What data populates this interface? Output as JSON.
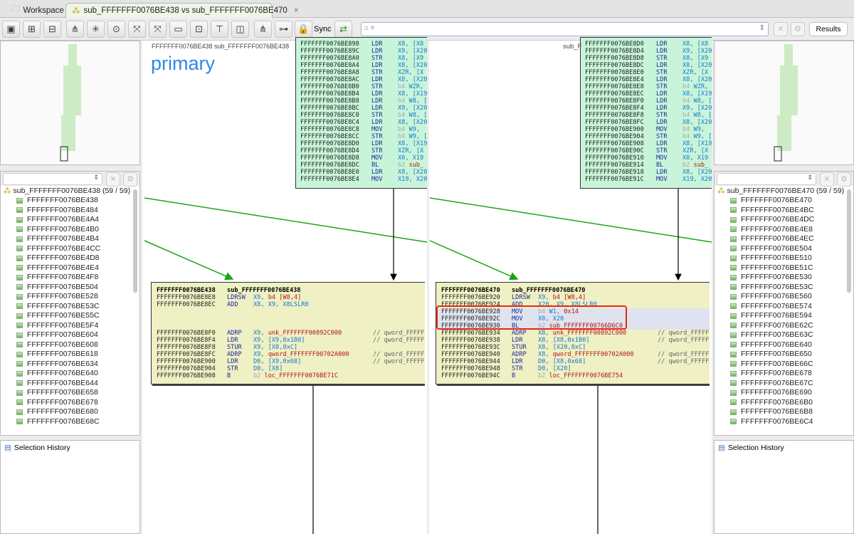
{
  "tabs": {
    "workspace": "Workspace",
    "diff": "sub_FFFFFFF0076BE438 vs sub_FFFFFFF0076BE470",
    "close": "×"
  },
  "toolbar": {
    "sync_label": "Sync",
    "results_label": "Results",
    "icons": [
      "single-view-icon",
      "dual-view-icon",
      "combined-view-icon",
      "hierarchic-layout-icon",
      "orthogonal-layout-icon",
      "circular-layout-icon",
      "zoom-to-fit-icon",
      "fit-graph-icon",
      "overview-icon",
      "proximity-icon",
      "flow-icon",
      "split-icon",
      "select-matched-icon",
      "select-unmatched-icon",
      "lock-icon"
    ]
  },
  "colors": {
    "arrow": "#1aa51a",
    "top_block": "#c8f5d9",
    "bottom_block": "#eff0c4",
    "highlight_box": "#e8261a",
    "primary_label": "#2f86e8"
  },
  "primary": {
    "header": "FFFFFFF0076BE438 sub_FFFFFFF0076BE438",
    "label": "primary"
  },
  "secondary": {
    "header": "sub_F"
  },
  "left_list": {
    "root": "sub_FFFFFFF0076BE438 (59 / 59)",
    "items": [
      "FFFFFFF0076BE438",
      "FFFFFFF0076BE484",
      "FFFFFFF0076BE4A4",
      "FFFFFFF0076BE4B0",
      "FFFFFFF0076BE4B4",
      "FFFFFFF0076BE4CC",
      "FFFFFFF0076BE4D8",
      "FFFFFFF0076BE4E4",
      "FFFFFFF0076BE4F8",
      "FFFFFFF0076BE504",
      "FFFFFFF0076BE528",
      "FFFFFFF0076BE53C",
      "FFFFFFF0076BE55C",
      "FFFFFFF0076BE5F4",
      "FFFFFFF0076BE604",
      "FFFFFFF0076BE608",
      "FFFFFFF0076BE618",
      "FFFFFFF0076BE634",
      "FFFFFFF0076BE640",
      "FFFFFFF0076BE644",
      "FFFFFFF0076BE658",
      "FFFFFFF0076BE678",
      "FFFFFFF0076BE680",
      "FFFFFFF0076BE68C"
    ]
  },
  "right_list": {
    "root": "sub_FFFFFFF0076BE470 (59 / 59)",
    "items": [
      "FFFFFFF0076BE470",
      "FFFFFFF0076BE4BC",
      "FFFFFFF0076BE4DC",
      "FFFFFFF0076BE4E8",
      "FFFFFFF0076BE4EC",
      "FFFFFFF0076BE504",
      "FFFFFFF0076BE510",
      "FFFFFFF0076BE51C",
      "FFFFFFF0076BE530",
      "FFFFFFF0076BE53C",
      "FFFFFFF0076BE560",
      "FFFFFFF0076BE574",
      "FFFFFFF0076BE594",
      "FFFFFFF0076BE62C",
      "FFFFFFF0076BE63C",
      "FFFFFFF0076BE640",
      "FFFFFFF0076BE650",
      "FFFFFFF0076BE66C",
      "FFFFFFF0076BE678",
      "FFFFFFF0076BE67C",
      "FFFFFFF0076BE690",
      "FFFFFFF0076BE6B0",
      "FFFFFFF0076BE6B8",
      "FFFFFFF0076BE6C4"
    ]
  },
  "selection_history": "Selection History",
  "blocks": {
    "left_top": [
      [
        "FFFFFFF0076BE898",
        "LDR",
        "",
        "X8, [X8",
        ""
      ],
      [
        "FFFFFFF0076BE89C",
        "LDR",
        "",
        "X9, [X20",
        ""
      ],
      [
        "FFFFFFF0076BE8A0",
        "STR",
        "",
        "X8, [X9",
        ""
      ],
      [
        "FFFFFFF0076BE8A4",
        "LDR",
        "",
        "X8, [X20",
        ""
      ],
      [
        "FFFFFFF0076BE8A8",
        "STR",
        "",
        "XZR, [X",
        ""
      ],
      [
        "FFFFFFF0076BE8AC",
        "LDR",
        "",
        "X8, [X20",
        ""
      ],
      [
        "FFFFFFF0076BE8B0",
        "STR",
        "b4 ",
        "WZR,",
        ""
      ],
      [
        "FFFFFFF0076BE8B4",
        "LDR",
        "",
        "X8, [X19",
        ""
      ],
      [
        "FFFFFFF0076BE8B8",
        "LDR",
        "b4 ",
        "W8, [",
        ""
      ],
      [
        "FFFFFFF0076BE8BC",
        "LDR",
        "",
        "X9, [X20",
        ""
      ],
      [
        "FFFFFFF0076BE8C0",
        "STR",
        "b4 ",
        "W8, [",
        ""
      ],
      [
        "FFFFFFF0076BE8C4",
        "LDR",
        "",
        "X8, [X20",
        ""
      ],
      [
        "FFFFFFF0076BE8C8",
        "MOV",
        "b4 ",
        "W9, ",
        ""
      ],
      [
        "FFFFFFF0076BE8CC",
        "STR",
        "b4 ",
        "W9, [",
        ""
      ],
      [
        "FFFFFFF0076BE8D0",
        "LDR",
        "",
        "X8, [X19",
        ""
      ],
      [
        "FFFFFFF0076BE8D4",
        "STR",
        "",
        "XZR, [X",
        ""
      ],
      [
        "FFFFFFF0076BE8D8",
        "MOV",
        "",
        "X0, X19",
        ""
      ],
      [
        "FFFFFFF0076BE8DC",
        "BL",
        "b2 ",
        "",
        "sub_"
      ],
      [
        "FFFFFFF0076BE8E0",
        "LDR",
        "",
        "X8, [X20",
        ""
      ],
      [
        "FFFFFFF0076BE8E4",
        "MOV",
        "",
        "X19, X20",
        ""
      ]
    ],
    "right_top": [
      [
        "FFFFFFF0076BE8D0",
        "LDR",
        "",
        "X8, [X8",
        ""
      ],
      [
        "FFFFFFF0076BE8D4",
        "LDR",
        "",
        "X9, [X20",
        ""
      ],
      [
        "FFFFFFF0076BE8D8",
        "STR",
        "",
        "X8, [X9",
        ""
      ],
      [
        "FFFFFFF0076BE8DC",
        "LDR",
        "",
        "X8, [X20",
        ""
      ],
      [
        "FFFFFFF0076BE8E0",
        "STR",
        "",
        "XZR, [X",
        ""
      ],
      [
        "FFFFFFF0076BE8E4",
        "LDR",
        "",
        "X8, [X20",
        ""
      ],
      [
        "FFFFFFF0076BE8E8",
        "STR",
        "b4 ",
        "WZR,",
        ""
      ],
      [
        "FFFFFFF0076BE8EC",
        "LDR",
        "",
        "X8, [X19",
        ""
      ],
      [
        "FFFFFFF0076BE8F0",
        "LDR",
        "b4 ",
        "W8, [",
        ""
      ],
      [
        "FFFFFFF0076BE8F4",
        "LDR",
        "",
        "X9, [X20",
        ""
      ],
      [
        "FFFFFFF0076BE8F8",
        "STR",
        "b4 ",
        "W8, [",
        ""
      ],
      [
        "FFFFFFF0076BE8FC",
        "LDR",
        "",
        "X8, [X20",
        ""
      ],
      [
        "FFFFFFF0076BE900",
        "MOV",
        "b4 ",
        "W9, ",
        ""
      ],
      [
        "FFFFFFF0076BE904",
        "STR",
        "b4 ",
        "W9, [",
        ""
      ],
      [
        "FFFFFFF0076BE908",
        "LDR",
        "",
        "X8, [X19",
        ""
      ],
      [
        "FFFFFFF0076BE90C",
        "STR",
        "",
        "XZR, [X",
        ""
      ],
      [
        "FFFFFFF0076BE910",
        "MOV",
        "",
        "X0, X19",
        ""
      ],
      [
        "FFFFFFF0076BE914",
        "BL",
        "b2 ",
        "",
        "sub_"
      ],
      [
        "FFFFFFF0076BE918",
        "LDR",
        "",
        "X8, [X20",
        ""
      ],
      [
        "FFFFFFF0076BE91C",
        "MOV",
        "",
        "X19, X20",
        ""
      ]
    ],
    "left_bottom": [
      [
        "FFFFFFF0076BE438",
        "sub_FFFFFFF0076BE438",
        "",
        "",
        "",
        ""
      ],
      [
        "FFFFFFF0076BE8E8",
        "LDRSW",
        "",
        "X9, ",
        "b4 [W8,4]",
        ""
      ],
      [
        "FFFFFFF0076BE8EC",
        "ADD",
        "",
        "X8, X9, X8LSLR0",
        "",
        ""
      ],
      [
        "",
        "",
        "",
        "",
        "",
        ""
      ],
      [
        "",
        "",
        "",
        "",
        "",
        ""
      ],
      [
        "",
        "",
        "",
        "",
        "",
        ""
      ],
      [
        "FFFFFFF0076BE8F0",
        "ADRP",
        "",
        "X9, ",
        "unk_FFFFFFF00892C000",
        "// qword_FFFFF"
      ],
      [
        "FFFFFFF0076BE8F4",
        "LDR",
        "",
        "X9, [X9,0x1B0]",
        "",
        "// qword_FFFFF"
      ],
      [
        "FFFFFFF0076BE8F8",
        "STUR",
        "",
        "X9, [X8,0xC]",
        "",
        ""
      ],
      [
        "FFFFFFF0076BE8FC",
        "ADRP",
        "",
        "X9, ",
        "qword_FFFFFFF00702A000",
        "// qword_FFFFF"
      ],
      [
        "FFFFFFF0076BE900",
        "LDR",
        "",
        "D0, [X9,0x68]",
        "",
        "// qword_FFFFF"
      ],
      [
        "FFFFFFF0076BE904",
        "STR",
        "",
        "D0, [X8]",
        "",
        ""
      ],
      [
        "FFFFFFF0076BE908",
        "B",
        "b2 ",
        "",
        "loc_FFFFFFF0076BE71C",
        ""
      ]
    ],
    "right_bottom": [
      [
        "FFFFFFF0076BE470",
        "sub_FFFFFFF0076BE470",
        "",
        "",
        "",
        ""
      ],
      [
        "FFFFFFF0076BE920",
        "LDRSW",
        "",
        "X9, ",
        "b4 [W8,4]",
        ""
      ],
      [
        "FFFFFFF0076BE924",
        "ADD",
        "",
        "X20, X9, X8LSLR0",
        "",
        ""
      ],
      [
        "FFFFFFF0076BE928",
        "MOV",
        "b4 ",
        "W1, ",
        "0x14",
        ""
      ],
      [
        "FFFFFFF0076BE92C",
        "MOV",
        "",
        "X0, X20",
        "",
        ""
      ],
      [
        "FFFFFFF0076BE930",
        "BL",
        "b2 ",
        "",
        "sub_FFFFFFF00766D6C0",
        ""
      ],
      [
        "FFFFFFF0076BE934",
        "ADRP",
        "",
        "X8, ",
        "unk_FFFFFFF00892C000",
        "// qword_FFFFF"
      ],
      [
        "FFFFFFF0076BE938",
        "LDR",
        "",
        "X8, [X8,0x1B0]",
        "",
        "// qword_FFFFF"
      ],
      [
        "FFFFFFF0076BE93C",
        "STUR",
        "",
        "X8, [X20,0xC]",
        "",
        ""
      ],
      [
        "FFFFFFF0076BE940",
        "ADRP",
        "",
        "X8, ",
        "qword_FFFFFFF00702A000",
        "// qword_FFFFF"
      ],
      [
        "FFFFFFF0076BE944",
        "LDR",
        "",
        "D0, [X8,0x68]",
        "",
        "// qword_FFFFF"
      ],
      [
        "FFFFFFF0076BE948",
        "STR",
        "",
        "D0, [X20]",
        "",
        ""
      ],
      [
        "FFFFFFF0076BE94C",
        "B",
        "b2 ",
        "",
        "loc_FFFFFFF0076BE754",
        ""
      ]
    ]
  }
}
